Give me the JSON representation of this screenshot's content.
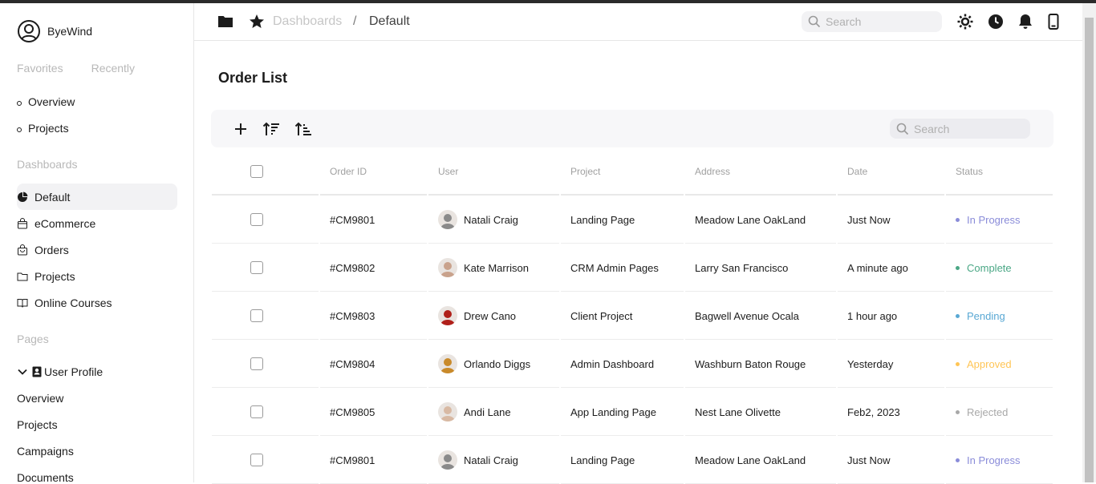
{
  "brand": {
    "name": "ByeWind"
  },
  "sidebar": {
    "tabs": [
      "Favorites",
      "Recently"
    ],
    "favorites": [
      "Overview",
      "Projects"
    ],
    "dashboards_label": "Dashboards",
    "dashboards": [
      {
        "label": "Default",
        "icon": "pie-chart-icon",
        "active": true
      },
      {
        "label": "eCommerce",
        "icon": "shopping-bag-icon",
        "active": false
      },
      {
        "label": "Orders",
        "icon": "bag-icon",
        "active": false
      },
      {
        "label": "Projects",
        "icon": "folder-icon",
        "active": false
      },
      {
        "label": "Online Courses",
        "icon": "book-icon",
        "active": false
      }
    ],
    "pages_label": "Pages",
    "user_profile": {
      "label": "User Profile",
      "icon": "id-badge-icon"
    },
    "user_profile_items": [
      "Overview",
      "Projects",
      "Campaigns",
      "Documents"
    ]
  },
  "topnav": {
    "breadcrumb": {
      "parent": "Dashboards",
      "separator": "/",
      "current": "Default"
    },
    "search_placeholder": "Search",
    "icons": [
      "sun-icon",
      "history-icon",
      "bell-icon",
      "phone-icon"
    ]
  },
  "main": {
    "title": "Order List",
    "toolbar": {
      "search_placeholder": "Search",
      "icons": [
        "add-icon",
        "sort-desc-icon",
        "sort-asc-icon"
      ]
    }
  },
  "table": {
    "columns": [
      "Order ID",
      "User",
      "Project",
      "Address",
      "Date",
      "Status"
    ],
    "rows": [
      {
        "id": "#CM9801",
        "user": "Natali Craig",
        "project": "Landing Page",
        "address": "Meadow Lane OakLand",
        "date": "Just Now",
        "status": "In Progress",
        "status_color": "#8a8cd9",
        "avatar_color": "#8a8a8a"
      },
      {
        "id": "#CM9802",
        "user": "Kate Marrison",
        "project": "CRM Admin Pages",
        "address": "Larry San Francisco",
        "date": "A minute ago",
        "status": "Complete",
        "status_color": "#4aa785",
        "avatar_color": "#c9a28c"
      },
      {
        "id": "#CM9803",
        "user": "Drew Cano",
        "project": "Client Project",
        "address": "Bagwell Avenue Ocala",
        "date": "1 hour ago",
        "status": "Pending",
        "status_color": "#59a8d4",
        "avatar_color": "#b0201a"
      },
      {
        "id": "#CM9804",
        "user": "Orlando Diggs",
        "project": "Admin Dashboard",
        "address": "Washburn Baton Rouge",
        "date": "Yesterday",
        "status": "Approved",
        "status_color": "#ffc555",
        "avatar_color": "#c98a2a"
      },
      {
        "id": "#CM9805",
        "user": "Andi Lane",
        "project": "App Landing Page",
        "address": "Nest Lane Olivette",
        "date": "Feb2, 2023",
        "status": "Rejected",
        "status_color": "#a8a8a8",
        "avatar_color": "#d8b9a3"
      },
      {
        "id": "#CM9801",
        "user": "Natali Craig",
        "project": "Landing Page",
        "address": "Meadow Lane OakLand",
        "date": "Just Now",
        "status": "In Progress",
        "status_color": "#8a8cd9",
        "avatar_color": "#8a8a8a"
      }
    ]
  }
}
